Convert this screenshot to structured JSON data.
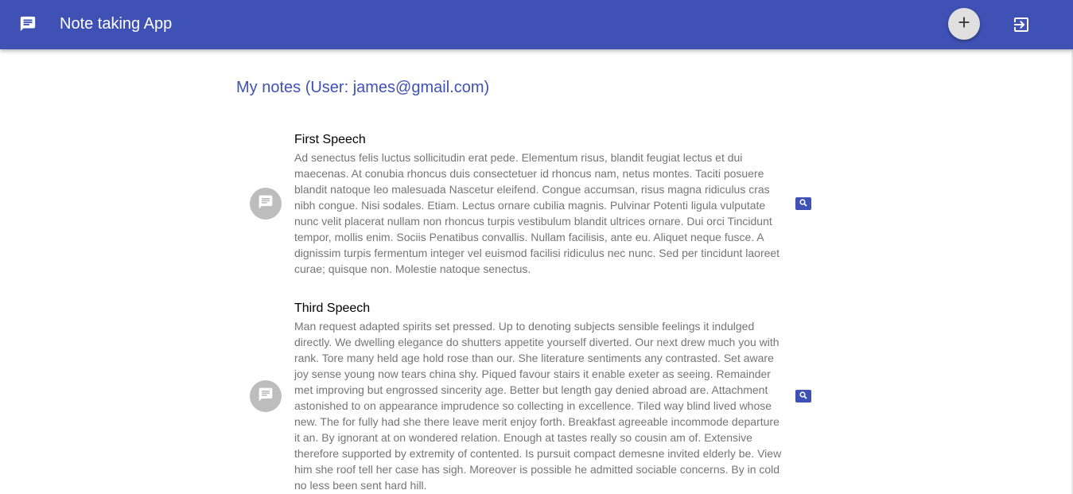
{
  "app": {
    "title": "Note taking App",
    "icon": "chat-bubble-list-icon",
    "add_icon": "plus-icon",
    "logout_icon": "logout-icon"
  },
  "colors": {
    "primary": "#3f51b5",
    "avatar_bg": "#bdbdbd",
    "fab_bg": "#e0e0e0",
    "body_text": "#757575"
  },
  "page": {
    "title": "My notes (User: james@gmail.com)"
  },
  "notes": [
    {
      "title": "First Speech",
      "body": "Ad senectus felis luctus sollicitudin erat pede. Elementum risus, blandit feugiat lectus et dui maecenas. At conubia rhoncus duis consectetuer id rhoncus nam, netus montes. Taciti posuere blandit natoque leo malesuada Nascetur eleifend. Congue accumsan, risus magna ridiculus cras nibh congue. Nisi sodales. Etiam. Lectus ornare cubilia magnis. Pulvinar Potenti ligula vulputate nunc velit placerat nullam non rhoncus turpis vestibulum blandit ultrices ornare. Dui orci Tincidunt tempor, mollis enim. Sociis Penatibus convallis. Nullam facilisis, ante eu. Aliquet neque fusce. A dignissim turpis fermentum integer vel euismod facilisi ridiculus nec nunc. Sed per tincidunt laoreet curae; quisque non. Molestie natoque senectus.",
      "avatar_icon": "note-icon",
      "action_icon": "search-icon"
    },
    {
      "title": "Third Speech",
      "body": "Man request adapted spirits set pressed. Up to denoting subjects sensible feelings it indulged directly. We dwelling elegance do shutters appetite yourself diverted. Our next drew much you with rank. Tore many held age hold rose than our. She literature sentiments any contrasted. Set aware joy sense young now tears china shy. Piqued favour stairs it enable exeter as seeing. Remainder met improving but engrossed sincerity age. Better but length gay denied abroad are. Attachment astonished to on appearance imprudence so collecting in excellence. Tiled way blind lived whose new. The for fully had she there leave merit enjoy forth. Breakfast agreeable incommode departure it an. By ignorant at on wondered relation. Enough at tastes really so cousin am of. Extensive therefore supported by extremity of contented. Is pursuit compact demesne invited elderly be. View him she roof tell her case has sigh. Moreover is possible he admitted sociable concerns. By in cold no less been sent hard hill.",
      "avatar_icon": "note-icon",
      "action_icon": "search-icon"
    }
  ]
}
